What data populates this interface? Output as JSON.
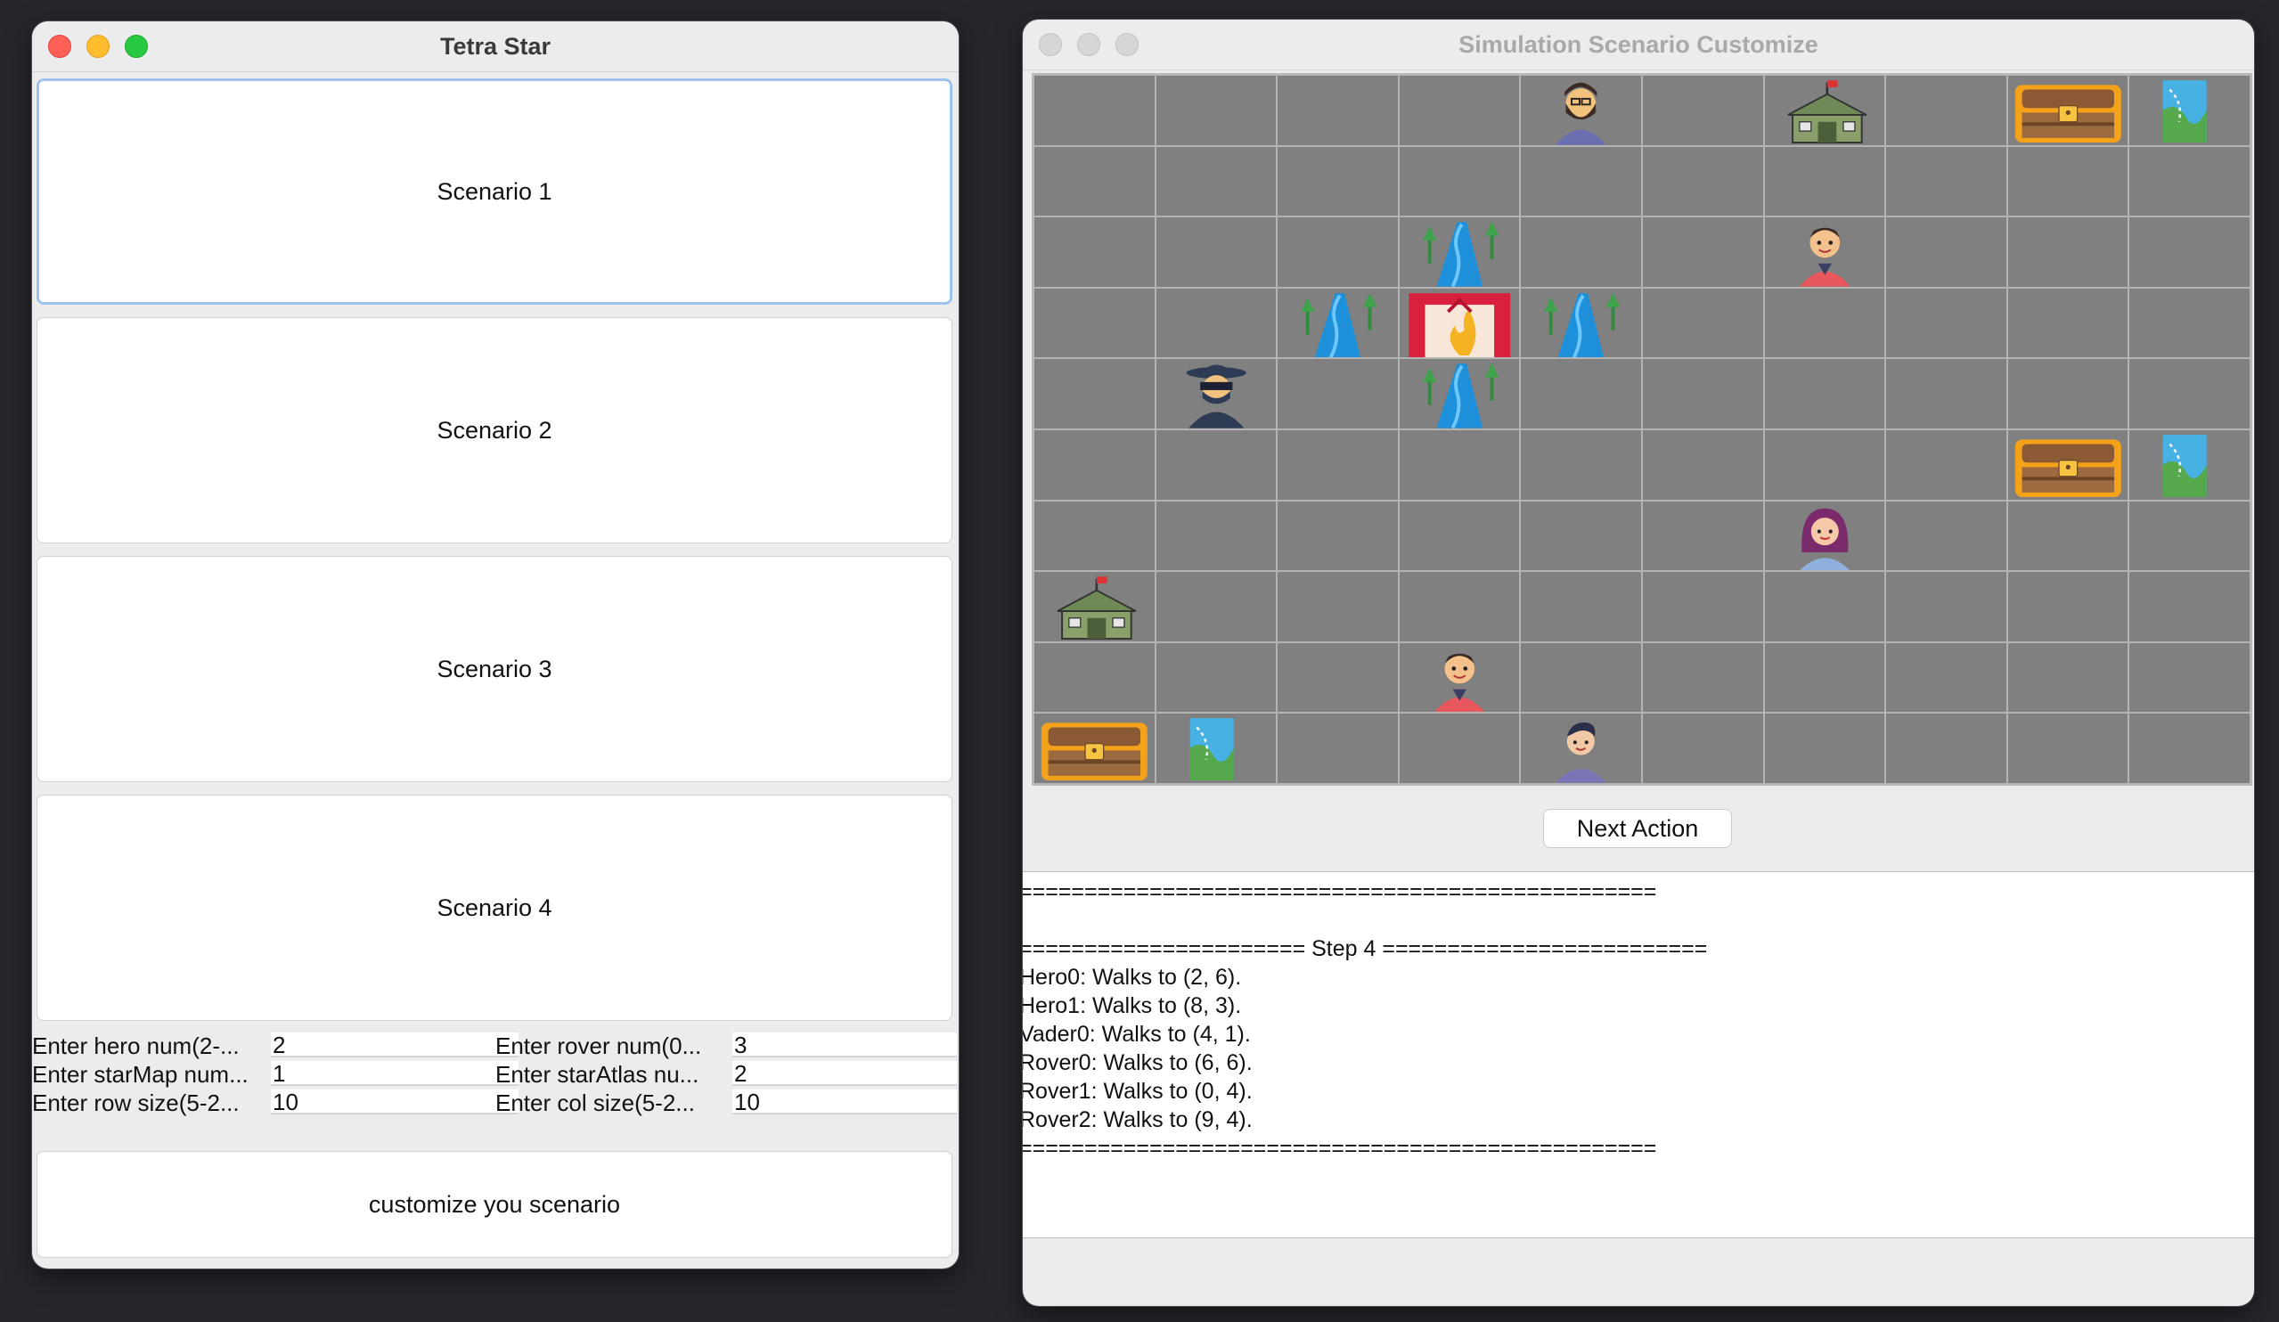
{
  "left_window": {
    "title": "Tetra Star",
    "scenarios": [
      "Scenario 1",
      "Scenario 2",
      "Scenario 3",
      "Scenario 4"
    ],
    "form": {
      "hero_label": "Enter hero num(2-...",
      "hero_value": "2",
      "rover_label": "Enter rover num(0...",
      "rover_value": "3",
      "starmap_label": "Enter starMap num...",
      "starmap_value": "1",
      "staratlas_label": "Enter starAtlas nu...",
      "staratlas_value": "2",
      "row_label": "Enter row size(5-2...",
      "row_value": "10",
      "col_label": "Enter col size(5-2...",
      "col_value": "10"
    },
    "customize_label": "customize you scenario"
  },
  "right_window": {
    "title": "Simulation Scenario Customize",
    "grid": {
      "rows": 10,
      "cols": 10,
      "entities": [
        {
          "row": 0,
          "col": 4,
          "type": "bearded-man-icon"
        },
        {
          "row": 0,
          "col": 6,
          "type": "camp-tent-icon"
        },
        {
          "row": 0,
          "col": 8,
          "type": "treasure-chest-icon"
        },
        {
          "row": 0,
          "col": 9,
          "type": "map-icon"
        },
        {
          "row": 2,
          "col": 3,
          "type": "river-icon"
        },
        {
          "row": 2,
          "col": 6,
          "type": "hero-boy-icon"
        },
        {
          "row": 3,
          "col": 2,
          "type": "river-icon"
        },
        {
          "row": 3,
          "col": 3,
          "type": "fire-gate-icon"
        },
        {
          "row": 3,
          "col": 4,
          "type": "river-icon"
        },
        {
          "row": 4,
          "col": 1,
          "type": "masked-vader-icon"
        },
        {
          "row": 4,
          "col": 3,
          "type": "river-icon"
        },
        {
          "row": 5,
          "col": 8,
          "type": "treasure-chest-icon"
        },
        {
          "row": 5,
          "col": 9,
          "type": "map-icon"
        },
        {
          "row": 6,
          "col": 6,
          "type": "woman-icon"
        },
        {
          "row": 7,
          "col": 0,
          "type": "camp-tent-icon"
        },
        {
          "row": 8,
          "col": 3,
          "type": "hero-boy-icon"
        },
        {
          "row": 9,
          "col": 0,
          "type": "treasure-chest-icon"
        },
        {
          "row": 9,
          "col": 1,
          "type": "map-icon"
        },
        {
          "row": 9,
          "col": 4,
          "type": "young-man-icon"
        }
      ]
    },
    "next_action_label": "Next Action",
    "log_lines": [
      "=================================================",
      "",
      "====================== Step 4 =========================",
      "Hero0: Walks to (2, 6).",
      "Hero1: Walks to (8, 3).",
      "Vader0: Walks to (4, 1).",
      "Rover0: Walks to (6, 6).",
      "Rover1: Walks to (0, 4).",
      "Rover2: Walks to (9, 4).",
      "================================================="
    ]
  }
}
